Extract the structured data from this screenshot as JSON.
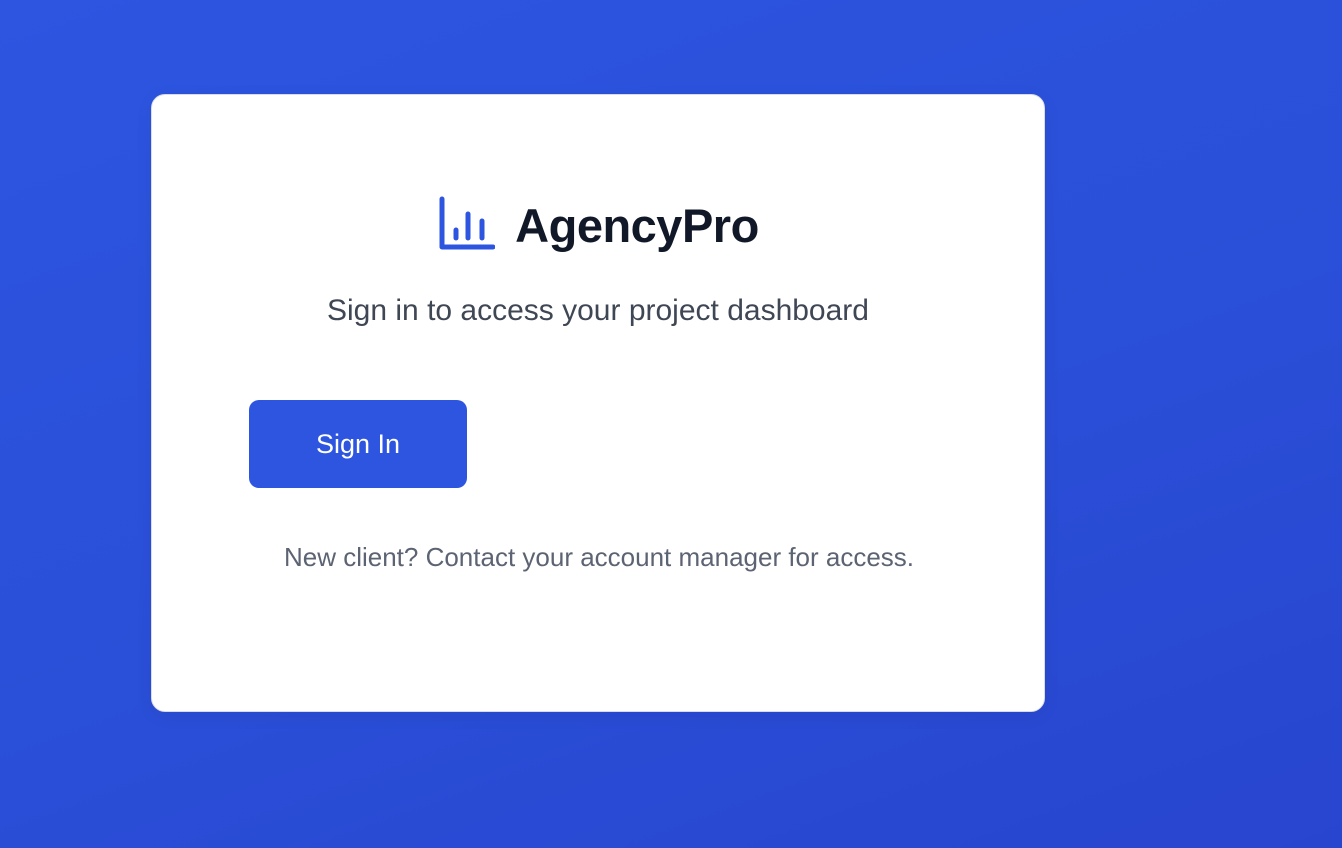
{
  "brand": {
    "name": "AgencyPro",
    "icon": "bar-chart-icon",
    "accent_color": "#2d55e0"
  },
  "subtitle": "Sign in to access your project dashboard",
  "signin": {
    "button_label": "Sign In"
  },
  "footnote": "New client? Contact your account manager for access.",
  "colors": {
    "background": "#2a4fd8",
    "card": "#ffffff",
    "button": "#2d55e0",
    "title_text": "#111827",
    "muted_text": "#5c6372"
  }
}
